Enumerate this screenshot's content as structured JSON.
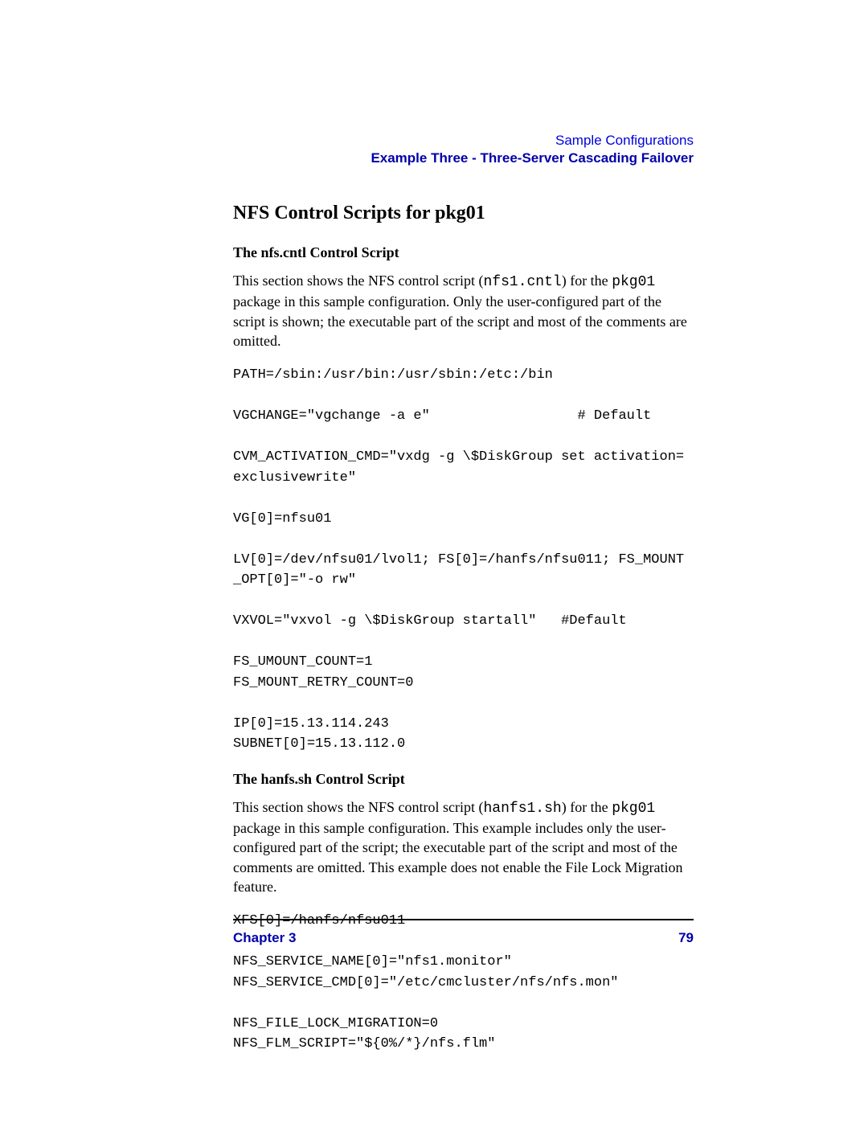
{
  "header": {
    "link": "Sample Configurations",
    "bold": "Example Three - Three-Server Cascading Failover"
  },
  "section_title": "NFS Control Scripts for pkg01",
  "sub1_heading": "The nfs.cntl Control Script",
  "para1_a": "This section shows the NFS control script (",
  "para1_code1": "nfs1.cntl",
  "para1_b": ") for the ",
  "para1_code2": "pkg01",
  "para1_c": " package in this sample configuration. Only the user-configured part of the script is shown; the executable part of the script and most of the comments are omitted.",
  "code1": "PATH=/sbin:/usr/bin:/usr/sbin:/etc:/bin\n\nVGCHANGE=\"vgchange -a e\"                  # Default\n\nCVM_ACTIVATION_CMD=\"vxdg -g \\$DiskGroup set activation=\nexclusivewrite\"\n\nVG[0]=nfsu01\n\nLV[0]=/dev/nfsu01/lvol1; FS[0]=/hanfs/nfsu011; FS_MOUNT\n_OPT[0]=\"-o rw\"\n\nVXVOL=\"vxvol -g \\$DiskGroup startall\"   #Default\n\nFS_UMOUNT_COUNT=1\nFS_MOUNT_RETRY_COUNT=0\n\nIP[0]=15.13.114.243\nSUBNET[0]=15.13.112.0",
  "sub2_heading": "The hanfs.sh Control Script",
  "para2_a": "This section shows the NFS control script (",
  "para2_code1": "hanfs1.sh",
  "para2_b": ") for the ",
  "para2_code2": "pkg01",
  "para2_c": " package in this sample configuration. This example includes only the user-configured part of the script; the executable part of the script and most of the comments are omitted. This example does not enable the File Lock Migration feature.",
  "code2": "XFS[0]=/hanfs/nfsu011\n\nNFS_SERVICE_NAME[0]=\"nfs1.monitor\"\nNFS_SERVICE_CMD[0]=\"/etc/cmcluster/nfs/nfs.mon\"\n\nNFS_FILE_LOCK_MIGRATION=0\nNFS_FLM_SCRIPT=\"${0%/*}/nfs.flm\"",
  "footer": {
    "chapter": "Chapter 3",
    "page": "79"
  }
}
